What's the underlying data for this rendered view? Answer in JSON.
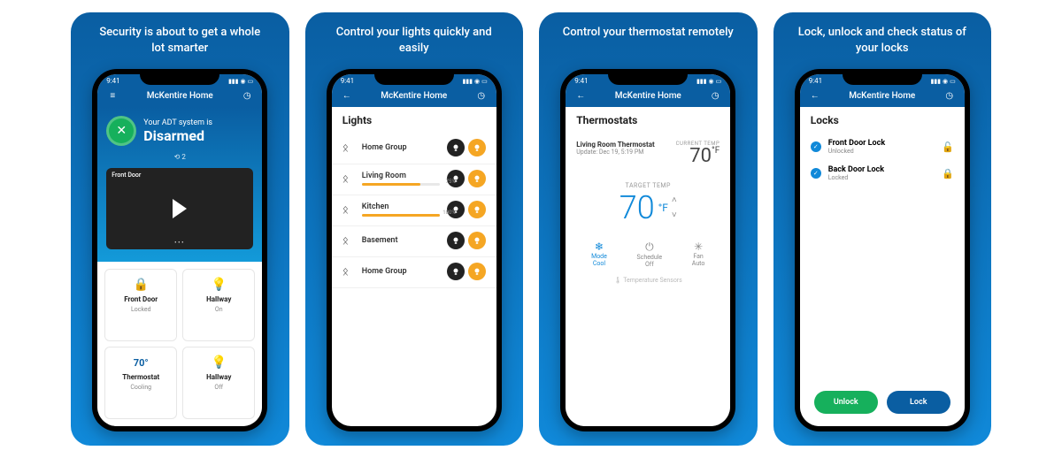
{
  "app": {
    "title": "McKentire Home",
    "time": "9:41"
  },
  "panels": [
    {
      "tagline": "Security is about to get a whole lot smarter",
      "dashboard": {
        "status_sub": "Your ADT system is",
        "status_main": "Disarmed",
        "zone_count": "2",
        "camera_label": "Front Door",
        "tiles": [
          {
            "icon": "lock-icon",
            "label": "Front Door",
            "sub": "Locked"
          },
          {
            "icon": "bulb-icon",
            "label": "Hallway",
            "sub": "On"
          },
          {
            "icon": "temp-icon",
            "label": "Thermostat",
            "sub": "Cooling",
            "icon_text": "70°"
          },
          {
            "icon": "bulb-off-icon",
            "label": "Hallway",
            "sub": "Off"
          }
        ]
      }
    },
    {
      "tagline": "Control your lights quickly and easily",
      "lights": {
        "title": "Lights",
        "rows": [
          {
            "name": "Home Group",
            "pct": null
          },
          {
            "name": "Living Room",
            "pct": 75
          },
          {
            "name": "Kitchen",
            "pct": 100
          },
          {
            "name": "Basement",
            "pct": null
          },
          {
            "name": "Home Group",
            "pct": null
          }
        ]
      }
    },
    {
      "tagline": "Control your thermostat remotely",
      "thermo": {
        "title": "Thermostats",
        "name": "Living Room Thermostat",
        "updated": "Update: Dec 19, 5:19 PM",
        "current_label": "CURRENT TEMP",
        "current": "70",
        "target_label": "TARGET TEMP",
        "target": "70",
        "modes": [
          {
            "label": "Mode",
            "sub": "Cool",
            "active": true
          },
          {
            "label": "Schedule",
            "sub": "Off",
            "active": false
          },
          {
            "label": "Fan",
            "sub": "Auto",
            "active": false
          }
        ],
        "sensors": "Temperature Sensors"
      }
    },
    {
      "tagline": "Lock, unlock and check status of your locks",
      "locks": {
        "title": "Locks",
        "rows": [
          {
            "name": "Front Door Lock",
            "status": "Unlocked",
            "color": "green"
          },
          {
            "name": "Back Door Lock",
            "status": "Locked",
            "color": "blue"
          }
        ],
        "unlock": "Unlock",
        "lock": "Lock"
      }
    }
  ]
}
